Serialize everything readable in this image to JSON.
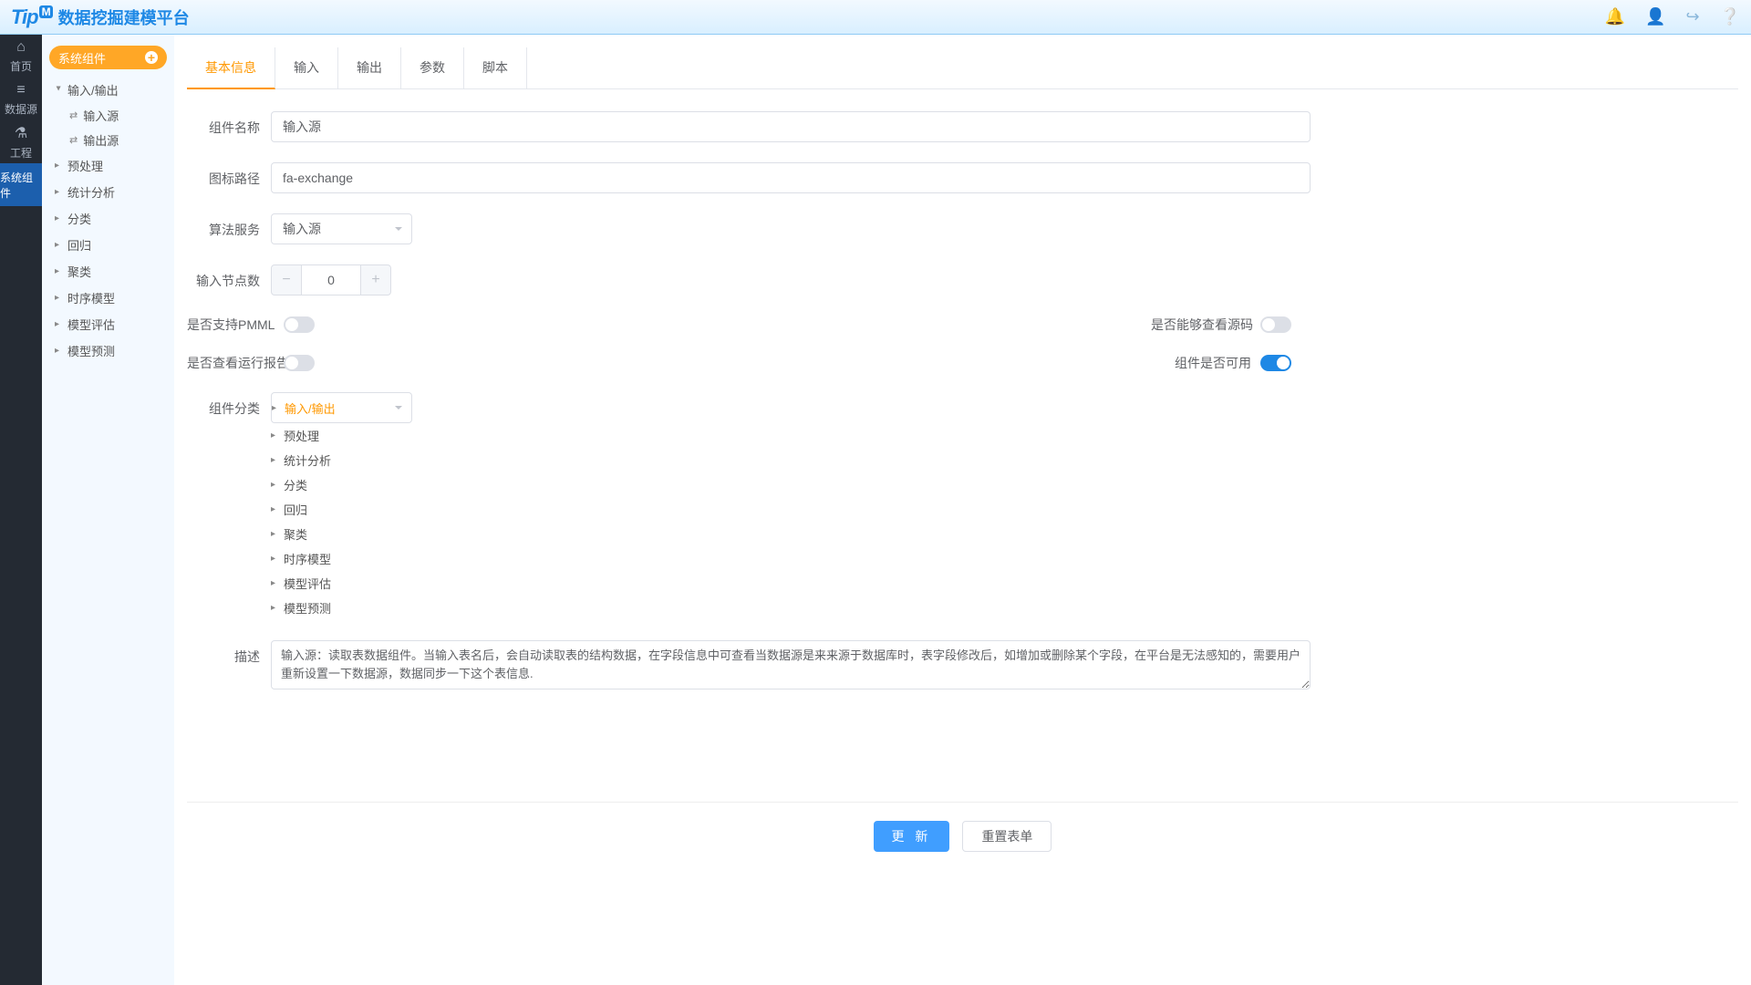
{
  "header": {
    "logo_main": "Tip",
    "logo_badge": "M",
    "title": "数据挖掘建模平台",
    "icons": [
      "bell-icon",
      "user-icon",
      "logout-icon",
      "help-icon"
    ]
  },
  "rail": [
    {
      "icon": "home-icon",
      "glyph": "⌂",
      "label": "首页"
    },
    {
      "icon": "database-icon",
      "glyph": "≡",
      "label": "数据源"
    },
    {
      "icon": "flask-icon",
      "glyph": "⚗",
      "label": "工程"
    },
    {
      "icon": "",
      "glyph": "",
      "label": "系统组件",
      "active": true
    }
  ],
  "tree": {
    "pill": "系统组件",
    "nodes": [
      {
        "label": "输入/输出",
        "open": true,
        "children": [
          {
            "label": "输入源"
          },
          {
            "label": "输出源"
          }
        ]
      },
      {
        "label": "预处理"
      },
      {
        "label": "统计分析"
      },
      {
        "label": "分类"
      },
      {
        "label": "回归"
      },
      {
        "label": "聚类"
      },
      {
        "label": "时序模型"
      },
      {
        "label": "模型评估"
      },
      {
        "label": "模型预测"
      }
    ]
  },
  "tabs": [
    {
      "label": "基本信息",
      "active": true
    },
    {
      "label": "输入"
    },
    {
      "label": "输出"
    },
    {
      "label": "参数"
    },
    {
      "label": "脚本"
    }
  ],
  "form": {
    "name": {
      "label": "组件名称",
      "value": "输入源"
    },
    "icon": {
      "label": "图标路径",
      "value": "fa-exchange"
    },
    "service": {
      "label": "算法服务",
      "value": "输入源"
    },
    "nodes": {
      "label": "输入节点数",
      "value": "0"
    },
    "pmml": {
      "label": "是否支持PMML",
      "on": false
    },
    "source": {
      "label": "是否能够查看源码",
      "on": false
    },
    "report": {
      "label": "是否查看运行报告",
      "on": false
    },
    "enable": {
      "label": "组件是否可用",
      "on": true
    },
    "category": {
      "label": "组件分类",
      "items": [
        {
          "label": "输入/输出",
          "sel": true
        },
        {
          "label": "预处理"
        },
        {
          "label": "统计分析"
        },
        {
          "label": "分类"
        },
        {
          "label": "回归"
        },
        {
          "label": "聚类"
        },
        {
          "label": "时序模型"
        },
        {
          "label": "模型评估"
        },
        {
          "label": "模型预测"
        }
      ]
    },
    "desc": {
      "label": "描述",
      "value": "输入源：读取表数据组件。当输入表名后，会自动读取表的结构数据，在字段信息中可查看当数据源是来来源于数据库时，表字段修改后，如增加或删除某个字段，在平台是无法感知的，需要用户重新设置一下数据源，数据同步一下这个表信息."
    }
  },
  "buttons": {
    "update": "更 新",
    "reset": "重置表单"
  }
}
